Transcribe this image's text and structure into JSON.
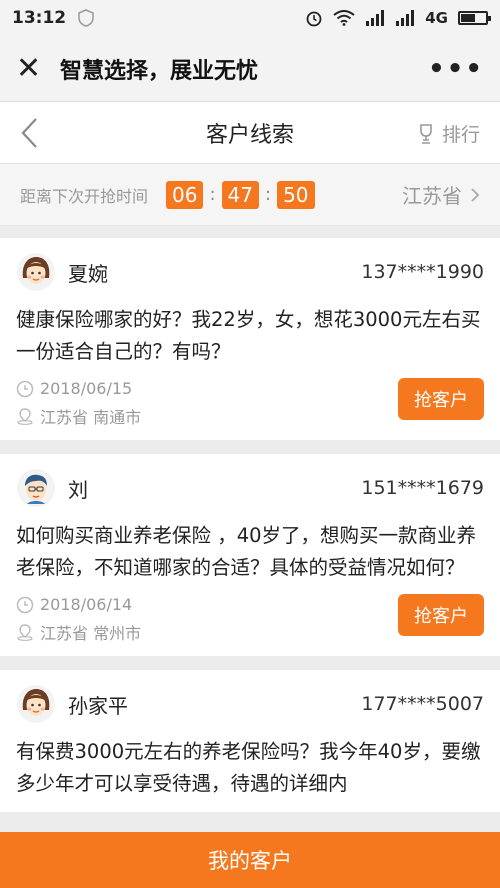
{
  "status": {
    "time": "13:12",
    "network": "4G"
  },
  "wechat": {
    "title": "智慧选择，展业无忧"
  },
  "nav": {
    "title": "客户线索",
    "rank_label": "排行"
  },
  "countdown": {
    "label": "距离下次开抢时间",
    "hours": "06",
    "minutes": "47",
    "seconds": "50",
    "province": "江苏省"
  },
  "leads": [
    {
      "name": "夏婉",
      "avatar": "female-avatar-icon",
      "phone": "137****1990",
      "question": "健康保险哪家的好？我22岁，女，想花3000元左右买一份适合自己的？有吗？",
      "date": "2018/06/15",
      "location": "江苏省 南通市",
      "button": "抢客户"
    },
    {
      "name": "刘",
      "avatar": "male-avatar-icon",
      "phone": "151****1679",
      "question": "如何购买商业养老保险 ，40岁了，想购买一款商业养老保险，不知道哪家的合适？具体的受益情况如何？",
      "date": "2018/06/14",
      "location": "江苏省 常州市",
      "button": "抢客户"
    },
    {
      "name": "孙家平",
      "avatar": "female-avatar-icon",
      "phone": "177****5007",
      "question": "有保费3000元左右的养老保险吗？我今年40岁，要缴多少年才可以享受待遇，待遇的详细内",
      "date": "",
      "location": "",
      "button": ""
    }
  ],
  "bottom": {
    "label": "我的客户"
  },
  "colors": {
    "accent": "#f5781f"
  }
}
